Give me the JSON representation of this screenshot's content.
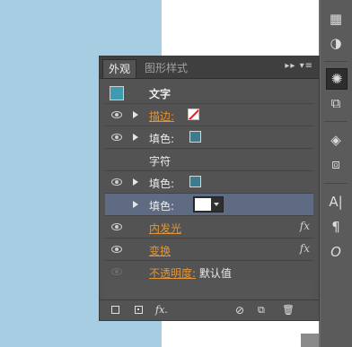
{
  "panel": {
    "tabs": [
      {
        "label": "外观"
      },
      {
        "label": "图形样式"
      }
    ],
    "tab_controls": "▸▸  ▾≡",
    "header": {
      "title": "文字",
      "swatch_color": "#3f9cb0"
    },
    "rows": [
      {
        "label": "描边:",
        "type": "stroke",
        "swatch": "none"
      },
      {
        "label": "填色:",
        "type": "fill",
        "swatch_color": "#3e7b8c"
      },
      {
        "label": "字符",
        "type": "group"
      },
      {
        "label": "填色:",
        "type": "fill",
        "swatch_color": "#3e7b8c"
      },
      {
        "label": "填色:",
        "type": "fill-selected",
        "dropdown_color": "#ffffff"
      },
      {
        "label": "内发光",
        "type": "effect"
      },
      {
        "label": "变换",
        "type": "effect"
      },
      {
        "label": "不透明度:",
        "value": "默认值",
        "type": "opacity"
      }
    ],
    "fx_label": "fx"
  },
  "footer": {
    "fx_label": "fx."
  },
  "toolbar": {
    "icons": [
      "layers-grid-icon",
      "appearance-icon",
      "graphic-styles-icon",
      "transform-icon",
      "layers-icon",
      "artboards-icon",
      "character-icon",
      "paragraph-icon",
      "opentype-icon"
    ],
    "character_glyph": "A|",
    "paragraph_glyph": "¶",
    "opentype_glyph": "O"
  }
}
